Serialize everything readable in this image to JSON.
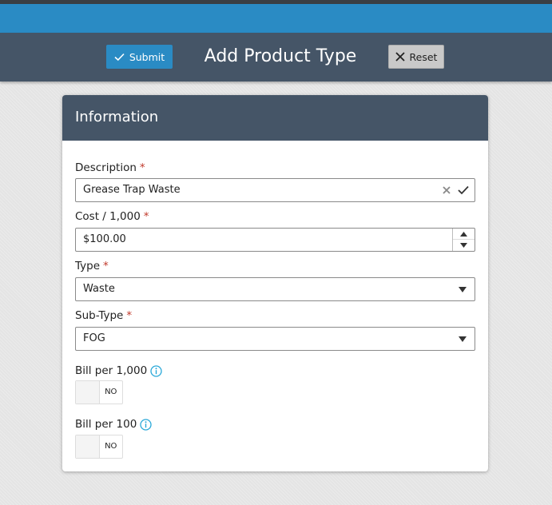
{
  "header": {
    "title": "Add Product Type",
    "submit_label": "Submit",
    "reset_label": "Reset"
  },
  "card": {
    "title": "Information"
  },
  "form": {
    "description": {
      "label": "Description",
      "required_mark": "*",
      "value": "Grease Trap Waste"
    },
    "cost": {
      "label": "Cost / 1,000",
      "required_mark": "*",
      "value": "$100.00"
    },
    "type": {
      "label": "Type",
      "required_mark": "*",
      "value": "Waste"
    },
    "subtype": {
      "label": "Sub-Type",
      "required_mark": "*",
      "value": "FOG"
    },
    "bill_per_1000": {
      "label": "Bill per 1,000",
      "toggle_text": "NO"
    },
    "bill_per_100": {
      "label": "Bill per 100",
      "toggle_text": "NO"
    }
  },
  "colors": {
    "accent": "#2a8bc4",
    "header_bg": "#455567",
    "required": "#c0392b",
    "info": "#29a8d8"
  },
  "icons": {
    "submit": "check-icon",
    "reset": "x-icon",
    "clear": "clear-icon",
    "validate": "check-icon",
    "info": "info-icon",
    "dropdown": "caret-down-icon"
  }
}
